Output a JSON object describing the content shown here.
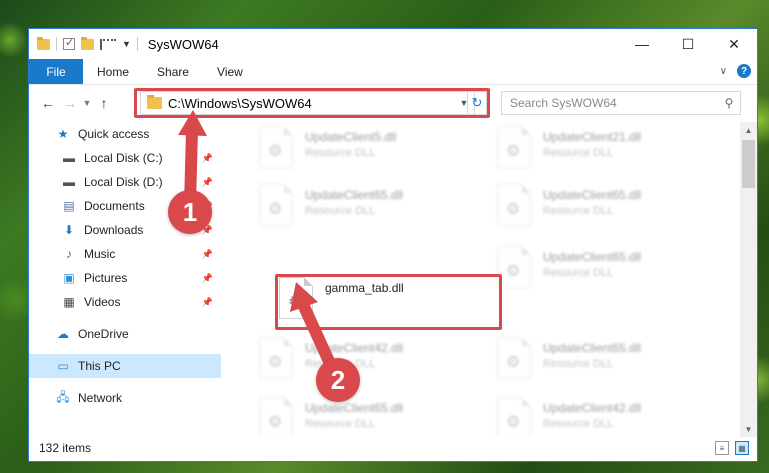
{
  "window": {
    "title": "SysWOW64",
    "controls": {
      "minimize": "—",
      "maximize": "☐",
      "close": "✕"
    }
  },
  "ribbon": {
    "file": "File",
    "tabs": [
      "Home",
      "Share",
      "View"
    ],
    "help": "?"
  },
  "navigation": {
    "address_path": "C:\\Windows\\SysWOW64",
    "search_placeholder": "Search SysWOW64"
  },
  "sidebar": {
    "items": [
      {
        "label": "Quick access",
        "icon": "star-icon"
      },
      {
        "label": "Local Disk (C:)",
        "icon": "drive-icon",
        "pinned": true
      },
      {
        "label": "Local Disk (D:)",
        "icon": "drive-icon",
        "pinned": true
      },
      {
        "label": "Documents",
        "icon": "documents-icon",
        "pinned": true
      },
      {
        "label": "Downloads",
        "icon": "downloads-icon",
        "pinned": true
      },
      {
        "label": "Music",
        "icon": "music-icon",
        "pinned": true
      },
      {
        "label": "Pictures",
        "icon": "pictures-icon",
        "pinned": true
      },
      {
        "label": "Videos",
        "icon": "videos-icon",
        "pinned": true
      },
      {
        "label": "OneDrive",
        "icon": "onedrive-icon"
      },
      {
        "label": "This PC",
        "icon": "this-pc-icon",
        "selected": true
      },
      {
        "label": "Network",
        "icon": "network-icon"
      }
    ]
  },
  "files": [
    {
      "name": "UpdateClient5.dll",
      "type": "Resource DLL",
      "blurred": true
    },
    {
      "name": "UpdateClient21.dll",
      "type": "Resource DLL",
      "blurred": true
    },
    {
      "name": "UpdateClient65.dll",
      "type": "Resource DLL",
      "blurred": true
    },
    {
      "name": "UpdateClient65.dll",
      "type": "Resource DLL",
      "blurred": true
    },
    {
      "name": "gamma_tab.dll",
      "type": "",
      "blurred": false
    },
    {
      "name": "UpdateClient65.dll",
      "type": "Resource DLL",
      "blurred": true
    },
    {
      "name": "UpdateClient42.dll",
      "type": "Resource DLL",
      "blurred": true
    },
    {
      "name": "UpdateClient65.dll",
      "type": "Resource DLL",
      "blurred": true
    },
    {
      "name": "UpdateClient65.dll",
      "type": "Resource DLL",
      "blurred": true
    },
    {
      "name": "UpdateClient42.dll",
      "type": "Resource DLL",
      "blurred": true
    }
  ],
  "status": {
    "item_count": "132 items"
  },
  "callouts": {
    "one": "1",
    "two": "2"
  },
  "colors": {
    "accent": "#1979ca",
    "highlight": "#d9494c",
    "selected_bg": "#cce8ff"
  }
}
